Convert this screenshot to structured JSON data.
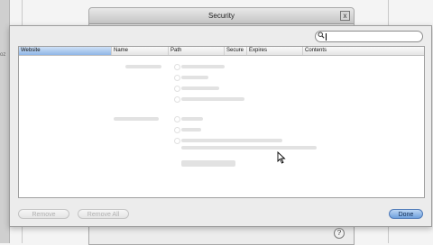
{
  "background_window": {
    "title": "Security",
    "edge_text": "oz",
    "close_symbol": "x",
    "help_symbol": "?"
  },
  "search": {
    "icon": "search-icon",
    "value": "",
    "placeholder": ""
  },
  "table": {
    "columns": [
      "Website",
      "Name",
      "Path",
      "Secure",
      "Expires",
      "Contents"
    ],
    "sorted_column": "Website",
    "rows": []
  },
  "buttons": {
    "remove": "Remove",
    "remove_all": "Remove All",
    "done": "Done"
  },
  "colors": {
    "selected_header": "#8fb6e6",
    "default_button": "#6fa0dc"
  }
}
